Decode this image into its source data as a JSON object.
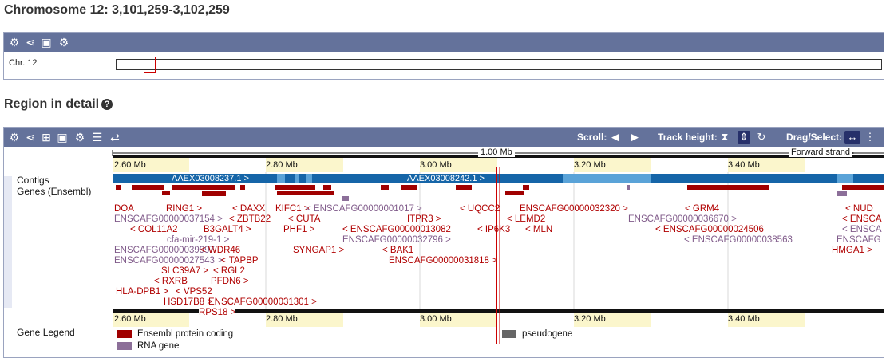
{
  "page": {
    "title": "Chromosome 12: 3,101,259-3,102,259",
    "region_heading": "Region in detail",
    "help_icon": "?"
  },
  "overview": {
    "chr_label": "Chr. 12"
  },
  "toolbar": {
    "scroll_label": "Scroll:",
    "track_height_label": "Track height:",
    "drag_select_label": "Drag/Select:"
  },
  "ruler": {
    "scale_label": "1.00 Mb",
    "strand_label": "Forward strand",
    "ticks": [
      "2.60 Mb",
      "2.80 Mb",
      "3.00 Mb",
      "3.20 Mb",
      "3.40 Mb"
    ]
  },
  "tracks": {
    "contigs": "Contigs",
    "genes": "Genes (Ensembl)",
    "legend": "Gene Legend"
  },
  "contigs": [
    "AAEX03008237.1 >",
    "AAEX03008242.1 >"
  ],
  "genes": [
    "DOA",
    "RING1 >",
    "< DAXX",
    "KIFC1 >",
    "< ENSCAFG00000001017 >",
    "< UQCC2",
    "ENSCAFG00000032320 >",
    "< GRM4",
    "< NUD",
    "ENSCAFG00000037154 >",
    "< ZBTB22",
    "< CUTA",
    "ITPR3 >",
    "< LEMD2",
    "ENSCAFG00000036670 >",
    "< ENSCA",
    "< COL11A2",
    "B3GALT4 >",
    "PHF1 >",
    "< ENSCAFG00000013082",
    "< IP6K3",
    "< MLN",
    "< ENSCAFG00000024506",
    "< ENSCA",
    "cfa-mir-219-1 >",
    "ENSCAFG00000032796 >",
    "< ENSCAFG00000038563",
    "ENSCAFG",
    "ENSCAFG00000039997",
    "< WDR46",
    "SYNGAP1 >",
    "< BAK1",
    "HMGA1 >",
    "ENSCAFG00000027543 >",
    "< TAPBP",
    "ENSCAFG00000031818 >",
    "SLC39A7 >",
    "< RGL2",
    "< RXRB",
    "PFDN6 >",
    "HLA-DPB1 >",
    "< VPS52",
    "HSD17B8 >",
    "ENSCAFG00000031301 >",
    "RPS18 >"
  ],
  "legend": {
    "protein_coding": "Ensembl protein coding",
    "rna_gene": "RNA gene",
    "pseudogene": "pseudogene",
    "colors": {
      "protein_coding": "#a00000",
      "rna_gene": "#8c6f99",
      "pseudogene": "#666666"
    }
  },
  "colors": {
    "toolbar": "#64729b",
    "contig_dark": "#1565a8",
    "contig_light": "#5aa3d8",
    "ruler_band": "#fbf6cc",
    "selection": "#cc0000"
  }
}
